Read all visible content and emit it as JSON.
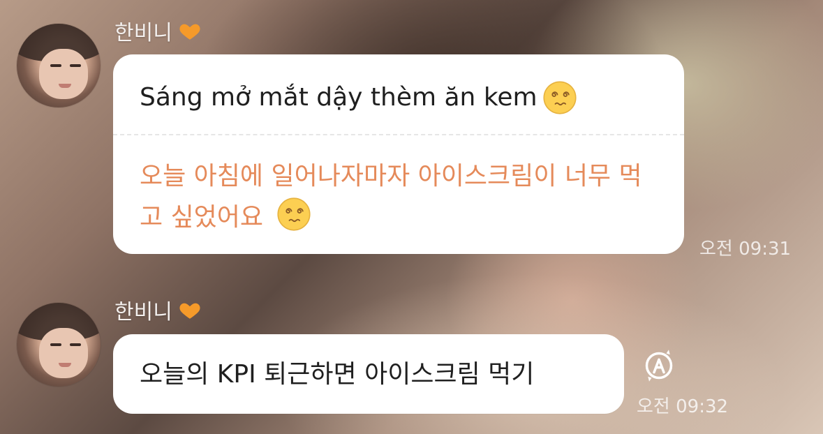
{
  "messages": [
    {
      "sender": "한비니",
      "text": "Sáng mở mắt dậy thèm ăn kem",
      "translation": "오늘 아침에 일어나자마자 아이스크림이 너무 먹고 싶었어요",
      "time": "오전 09:31"
    },
    {
      "sender": "한비니",
      "text": "오늘의 KPI 퇴근하면 아이스크림 먹기",
      "time": "오전 09:32"
    }
  ],
  "icons": {
    "heart": "orange-heart-icon",
    "emoji": "dizzy-face-emoji-icon",
    "translate": "translate-icon"
  },
  "colors": {
    "translation_text": "#e58a5a",
    "heart": "#f59a2a"
  }
}
